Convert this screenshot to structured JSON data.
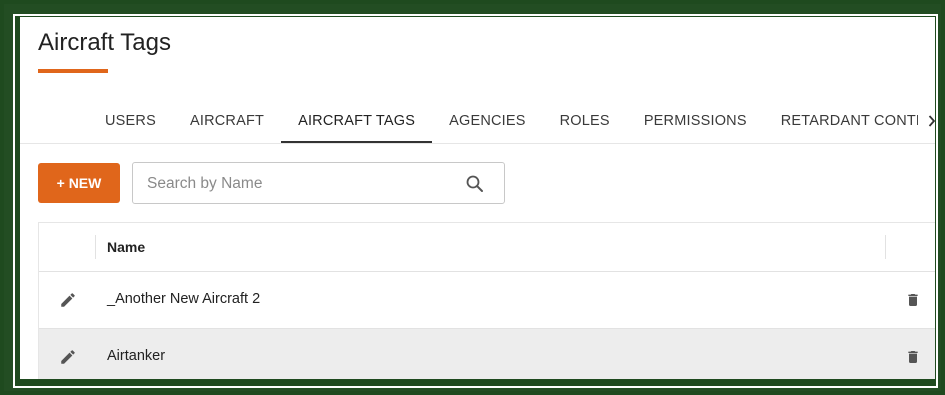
{
  "page": {
    "title": "Aircraft Tags",
    "accent_color": "#e0661b"
  },
  "tabs": [
    {
      "label": "USERS",
      "active": false
    },
    {
      "label": "AIRCRAFT",
      "active": false
    },
    {
      "label": "AIRCRAFT TAGS",
      "active": true
    },
    {
      "label": "AGENCIES",
      "active": false
    },
    {
      "label": "ROLES",
      "active": false
    },
    {
      "label": "PERMISSIONS",
      "active": false
    },
    {
      "label": "RETARDANT CONTRACTS",
      "active": false
    }
  ],
  "toolbar": {
    "new_label": "+ NEW",
    "search_placeholder": "Search by Name",
    "search_value": ""
  },
  "table": {
    "columns": [
      "Name"
    ],
    "rows": [
      {
        "name": "_Another New Aircraft 2"
      },
      {
        "name": "Airtanker"
      }
    ]
  },
  "icons": {
    "search": "search-icon",
    "edit": "pencil-icon",
    "delete": "trash-icon",
    "scroll": "chevron-right-icon"
  }
}
